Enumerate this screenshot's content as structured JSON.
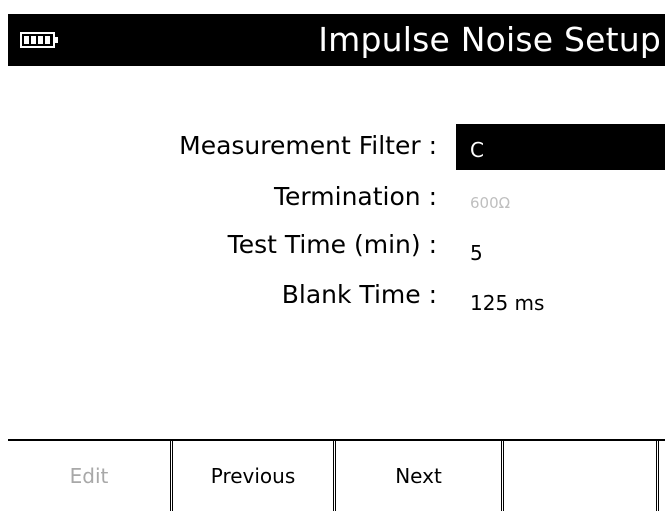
{
  "header": {
    "title": "Impulse Noise Setup",
    "battery_icon": "battery-full-icon"
  },
  "fields": [
    {
      "label": "Measurement Filter :",
      "value": "C"
    },
    {
      "label": "Termination :",
      "value": "600Ω"
    },
    {
      "label": "Test Time (min) :",
      "value": "5"
    },
    {
      "label": "Blank Time :",
      "value": "125 ms"
    }
  ],
  "softkeys": [
    {
      "label": "Edit"
    },
    {
      "label": "Previous"
    },
    {
      "label": "Next"
    },
    {
      "label": ""
    }
  ],
  "colors": {
    "background": "#ffffff",
    "title_bar": "#000000",
    "disabled_text": "#a8a8a8"
  }
}
